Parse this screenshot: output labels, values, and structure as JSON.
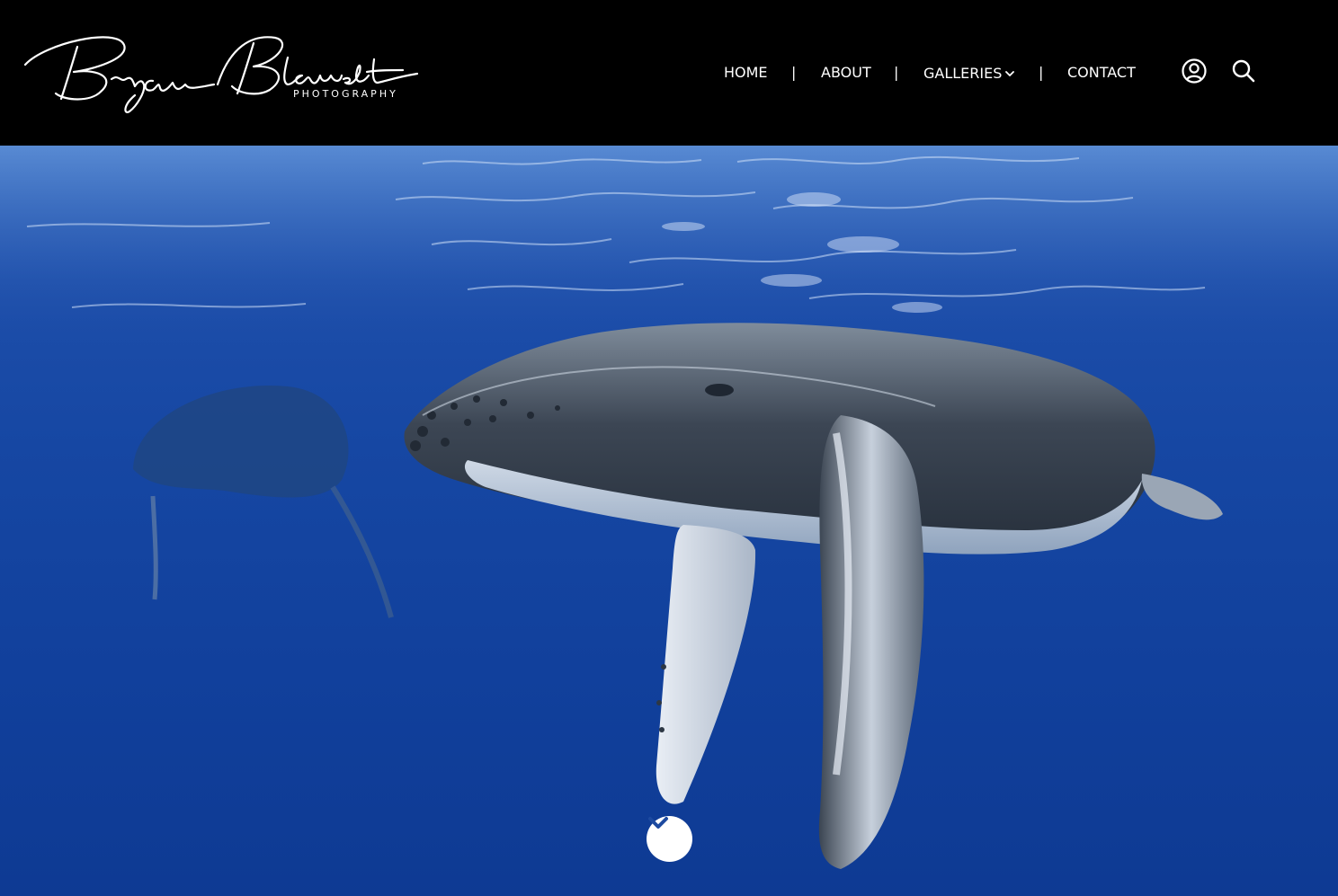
{
  "brand": {
    "script_name": "Bryan Blauvelt",
    "subtitle": "PHOTOGRAPHY"
  },
  "nav": {
    "items": [
      {
        "label": "HOME"
      },
      {
        "label": "ABOUT"
      },
      {
        "label": "GALLERIES",
        "has_dropdown": true
      },
      {
        "label": "CONTACT"
      }
    ],
    "separator": "|"
  },
  "header_icons": [
    "account-icon",
    "search-icon"
  ],
  "hero": {
    "image_subject": "humpback whale underwater",
    "scroll_icon": "chevron-down-icon"
  },
  "colors": {
    "header_bg": "#000000",
    "ocean": "#1647a3",
    "text": "#ffffff",
    "scroll_chevron": "#1d4aa0"
  }
}
